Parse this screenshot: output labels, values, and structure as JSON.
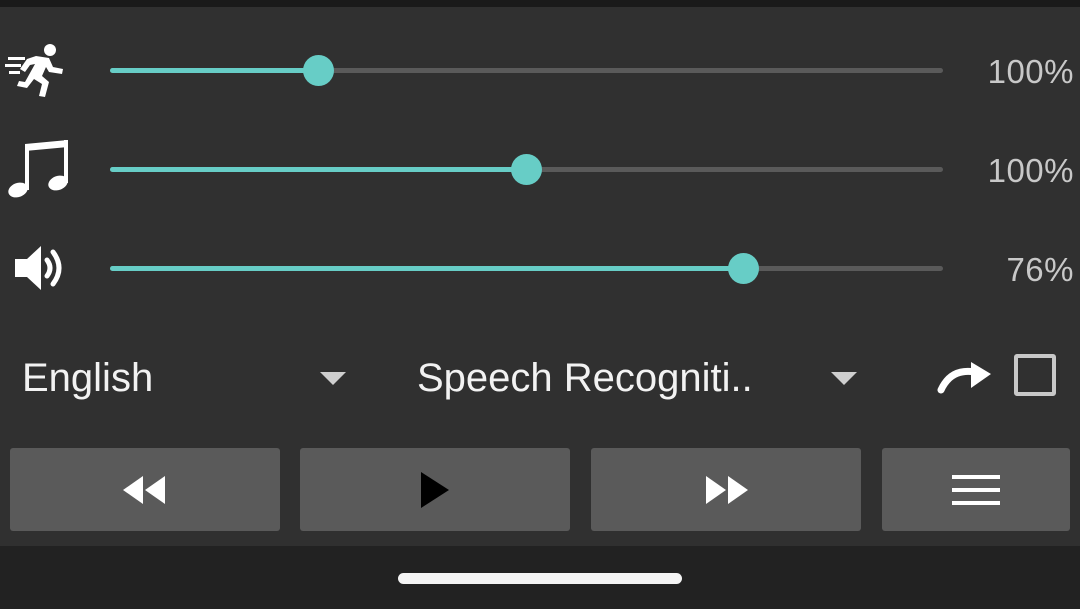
{
  "colors": {
    "background": "#303030",
    "accent": "#67cdc6",
    "track": "#5a5a5a",
    "button": "#5a5a5a",
    "nav_bar": "#222222"
  },
  "sliders": [
    {
      "icon": "running-man-icon",
      "name": "speed",
      "value_pct": 25,
      "label": "100%"
    },
    {
      "icon": "music-note-icon",
      "name": "pitch",
      "value_pct": 50,
      "label": "100%"
    },
    {
      "icon": "speaker-volume-icon",
      "name": "volume",
      "value_pct": 76,
      "label": "76%"
    }
  ],
  "language_select": {
    "value": "English",
    "icon": "caret-down-icon"
  },
  "mode_select": {
    "value": "Speech Recogniti..",
    "icon": "caret-down-icon"
  },
  "repeat": {
    "icon": "redo-arrow-icon"
  },
  "checkbox": {
    "checked": false
  },
  "controls": {
    "rewind": {
      "icon": "rewind-icon"
    },
    "play": {
      "icon": "play-icon"
    },
    "fast_forward": {
      "icon": "fast-forward-icon"
    },
    "menu": {
      "icon": "hamburger-menu-icon"
    }
  },
  "nav": {
    "home_indicator": "home-indicator"
  }
}
